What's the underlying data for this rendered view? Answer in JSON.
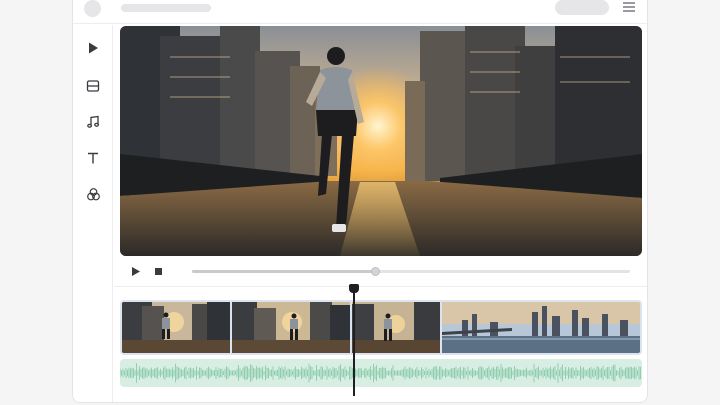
{
  "window": {
    "title_placeholder": "",
    "action_placeholder": ""
  },
  "icons": {
    "menu": "hamburger-menu-icon",
    "sidebar": [
      "play-icon",
      "layout-icon",
      "music-note-icon",
      "text-icon",
      "color-circles-icon"
    ],
    "controls": [
      "play-icon",
      "stop-icon"
    ]
  },
  "preview": {
    "subject": "runner-city-sunset"
  },
  "playback": {
    "progress": 0.42
  },
  "timeline": {
    "clips": [
      {
        "scene": "runner-street-wide"
      },
      {
        "scene": "runner-street-mid"
      },
      {
        "scene": "runner-street-close"
      },
      {
        "scene": "city-skyline-bridge"
      }
    ],
    "playhead_fraction": 0.447
  },
  "colors": {
    "accent": "#1f1f23",
    "audio_track": "#d8eee3",
    "waveform": "#8fcfb0",
    "clip_border": "#dbe3ee",
    "sunset": "#f7b347"
  }
}
